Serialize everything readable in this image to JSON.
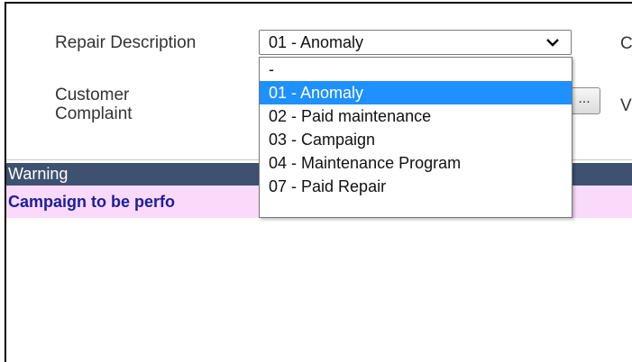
{
  "form": {
    "repair_description_label": "Repair Description",
    "customer_complaint_label_line1": "Customer",
    "customer_complaint_label_line2": "Complaint",
    "repair_description_value": "01 - Anomaly",
    "right_cut_text_1": "C",
    "right_cut_text_2": "V",
    "ellipsis_label": "..."
  },
  "dropdown": {
    "options": [
      "-",
      "01 - Anomaly",
      "02 - Paid maintenance",
      "03 - Campaign",
      "04 - Maintenance Program",
      "07 - Paid Repair"
    ],
    "selected_index": 1
  },
  "warning": {
    "header": "Warning",
    "message": "Campaign to be perfo"
  },
  "colors": {
    "warning_header_bg": "#3e5170",
    "warning_message_bg": "#f9dafa",
    "warning_message_text": "#1d1d9c",
    "selected_option_bg": "#1e90ff"
  }
}
